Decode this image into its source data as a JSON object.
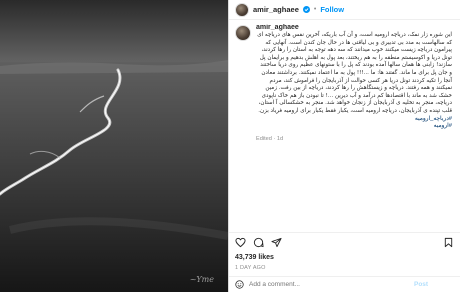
{
  "header": {
    "username": "amir_aghaee",
    "separator": "•",
    "follow_label": "Follow"
  },
  "photo": {
    "signature": "~Yme"
  },
  "caption": {
    "username": "amir_aghaee",
    "text": "این شوره زار نمک، دریاچه ارومیه است، و آن آب باریکه، آخرین نفس های دریاچه ای که سالهاست به مدد بی تدبیری و بی لیاقتی ها در حال جان کندن است. آنهایی که پیرامون دریاچه زیست میکنند خوب میدانند که سه دهه توجه به استان را رها کردند، تونل دریا و اکوسیستم منطقه را به هم ریختند، بعد پول به اهلش بدهیم و برایمان پل سازند! زابنی ها همان سالها آمده بودند که پل را با ستونهای عظیم روی دریا ساختند و جان پل برای ما ماند. گفتند ها: ما ...!!! پول به ما اعتماد نمیکنند. برداشتند معادن آنجا را تکیه کردند تونل دریا هر کسی حوالت از آذربایجان را فراموش کند، مردم نمیکنند و همه رفتند. دریاچه و زیستگاهش را رها کردند، دریاچه از بین رفت. زمین خشک شد به ماند با اقتصادها کم درآمد و آب دیرین ...! تا نبودن باز هم خاک ناپودی دریاچه، منجر به تخلیه ی آذربایجان از زنجان خواهد شد. منجر به خشکسالی آ استان، قلب تپنده ی آذربایجان، دریاچه ارومیه است، یکبار فقط یکبار برای ارومیه فریاد بزن.",
    "hashtags": [
      "#دریاچه_ارومیه",
      "#ارومیه"
    ],
    "edited": "Edited · 1d"
  },
  "actions": {
    "icons": [
      "heart-icon",
      "comment-icon",
      "share-icon",
      "bookmark-icon"
    ]
  },
  "stats": {
    "likes": "43,739 likes",
    "time_ago": "1 DAY AGO"
  },
  "comment": {
    "placeholder": "Add a comment...",
    "post_label": "Post"
  },
  "colors": {
    "accent": "#0095f6",
    "hashtag": "#00376b",
    "muted": "#8e8e8e",
    "post_disabled": "#b2dffc"
  }
}
